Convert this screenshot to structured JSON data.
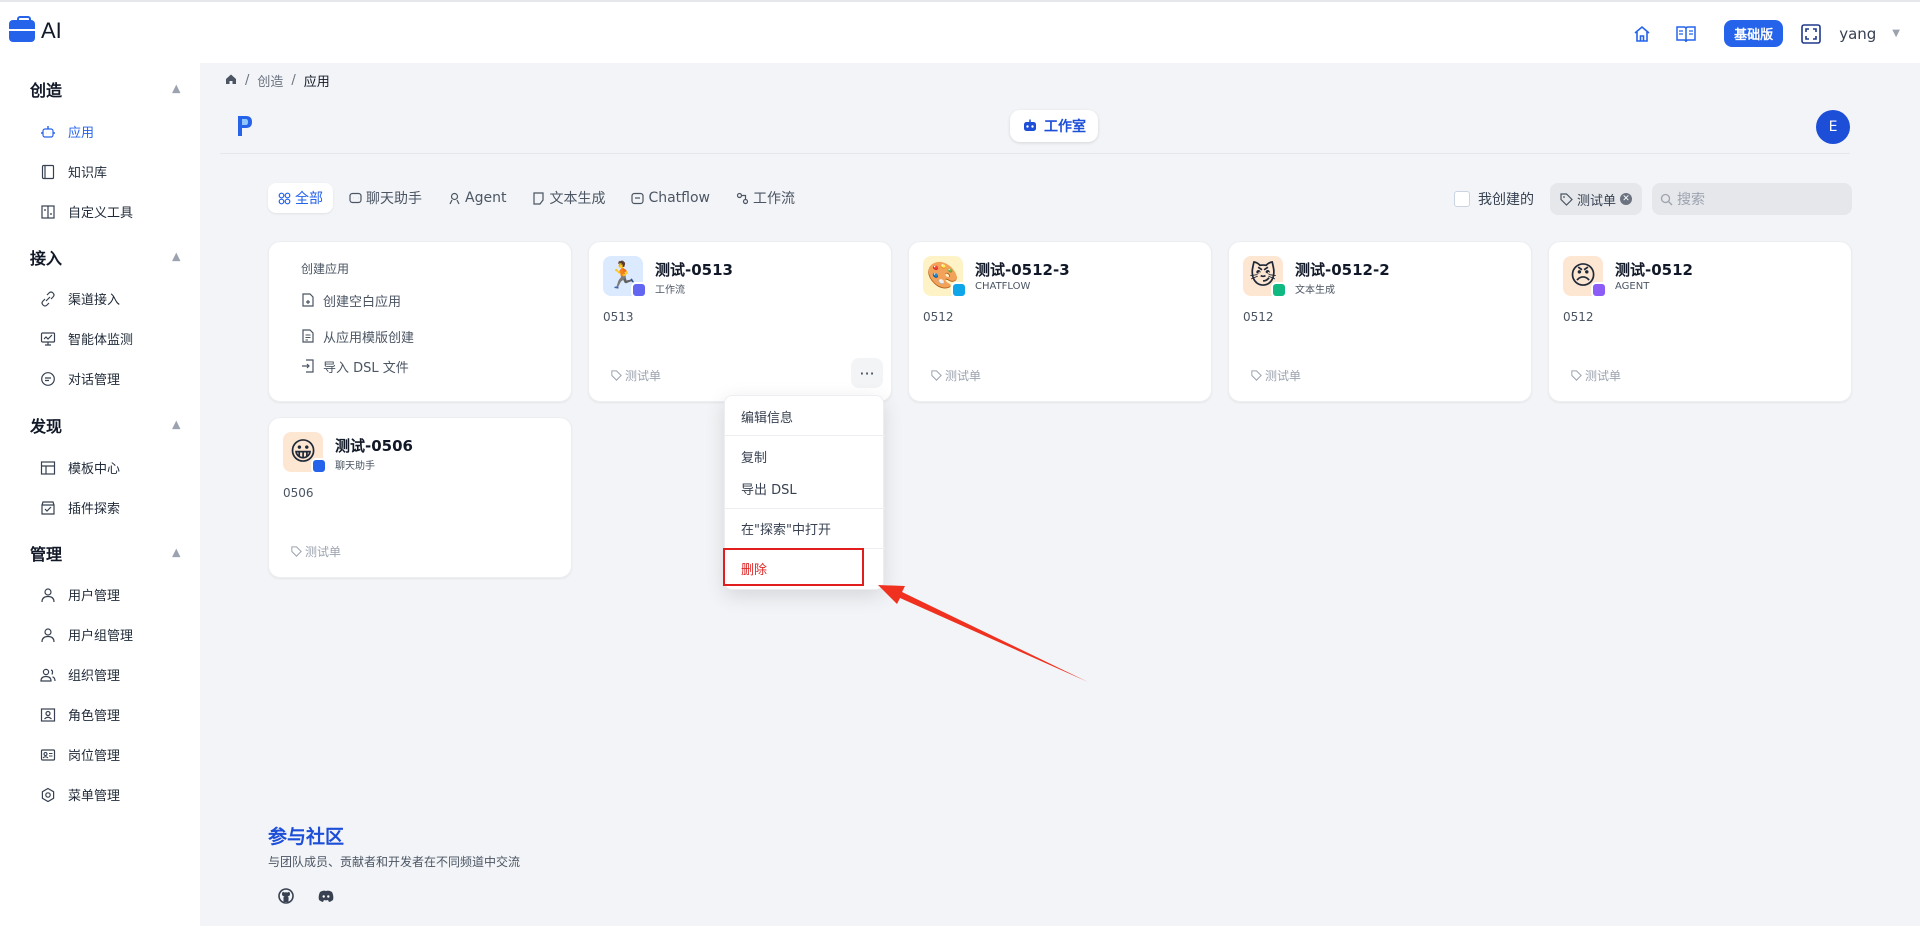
{
  "app": {
    "logo_text": "AI"
  },
  "topbar": {
    "version_badge": "基础版",
    "username": "yang"
  },
  "sidebar": {
    "sections": [
      {
        "title": "创造",
        "items": [
          {
            "label": "应用",
            "icon": "robot-icon",
            "active": true
          },
          {
            "label": "知识库",
            "icon": "book-icon"
          },
          {
            "label": "自定义工具",
            "icon": "tool-icon"
          }
        ]
      },
      {
        "title": "接入",
        "items": [
          {
            "label": "渠道接入",
            "icon": "link-icon"
          },
          {
            "label": "智能体监测",
            "icon": "monitor-icon"
          },
          {
            "label": "对话管理",
            "icon": "chat-icon"
          }
        ]
      },
      {
        "title": "发现",
        "items": [
          {
            "label": "模板中心",
            "icon": "template-icon"
          },
          {
            "label": "插件探索",
            "icon": "store-icon"
          }
        ]
      },
      {
        "title": "管理",
        "items": [
          {
            "label": "用户管理",
            "icon": "user-icon"
          },
          {
            "label": "用户组管理",
            "icon": "user-group-icon"
          },
          {
            "label": "组织管理",
            "icon": "org-icon"
          },
          {
            "label": "角色管理",
            "icon": "role-icon"
          },
          {
            "label": "岗位管理",
            "icon": "post-icon"
          },
          {
            "label": "菜单管理",
            "icon": "menu-gear-icon"
          }
        ]
      }
    ]
  },
  "breadcrumb": {
    "sep": "/",
    "level1": "创造",
    "current": "应用"
  },
  "studio": {
    "tab_label": "工作室",
    "avatar_letter": "E"
  },
  "filters": {
    "tabs": [
      "全部",
      "聊天助手",
      "Agent",
      "文本生成",
      "Chatflow",
      "工作流"
    ],
    "mine_label": "我创建的",
    "tag_label": "测试单",
    "search_placeholder": "搜索"
  },
  "create_card": {
    "title": "创建应用",
    "items": [
      "创建空白应用",
      "从应用模版创建",
      "导入 DSL 文件"
    ]
  },
  "apps": [
    {
      "name": "测试-0513",
      "type": "工作流",
      "desc": "0513",
      "tag": "测试单",
      "emoji": "🏃",
      "bg": "#dbeafe",
      "badge": "#6366f1"
    },
    {
      "name": "测试-0512-3",
      "type": "CHATFLOW",
      "desc": "0512",
      "tag": "测试单",
      "emoji": "🎨",
      "bg": "#fef3c7",
      "badge": "#0ea5e9"
    },
    {
      "name": "测试-0512-2",
      "type": "文本生成",
      "desc": "0512",
      "tag": "测试单",
      "emoji": "😼",
      "bg": "#fde6d2",
      "badge": "#10b981"
    },
    {
      "name": "测试-0512",
      "type": "AGENT",
      "desc": "0512",
      "tag": "测试单",
      "emoji": "😠",
      "bg": "#fde6d2",
      "badge": "#8b5cf6"
    },
    {
      "name": "测试-0506",
      "type": "聊天助手",
      "desc": "0506",
      "tag": "测试单",
      "emoji": "😀",
      "bg": "#fde6d2",
      "badge": "#2563eb"
    }
  ],
  "more_menu": {
    "items": [
      "编辑信息",
      "复制",
      "导出 DSL",
      "在\"探索\"中打开",
      "删除"
    ]
  },
  "community": {
    "title": "参与社区",
    "subtitle": "与团队成员、贡献者和开发者在不同频道中交流"
  }
}
